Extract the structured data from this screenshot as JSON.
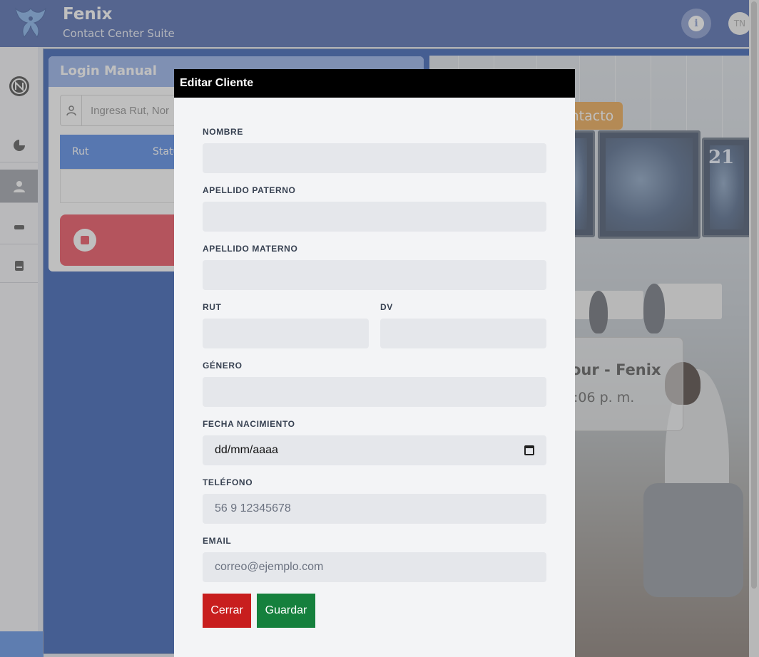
{
  "app": {
    "title": "Fenix",
    "subtitle": "Contact Center Suite",
    "avatar_initials": "TN",
    "info_icon": "i"
  },
  "sidebar": {
    "items": [
      {
        "icon": "logo-circle-icon"
      },
      {
        "icon": "pie-chart-icon"
      },
      {
        "icon": "user-icon",
        "active": true
      },
      {
        "icon": "minus-icon"
      },
      {
        "icon": "document-icon"
      }
    ]
  },
  "login": {
    "title": "Login Manual",
    "search_placeholder": "Ingresa Rut, Nor",
    "columns": [
      "Rut",
      "Statu"
    ]
  },
  "background": {
    "contact_button": "ontacto",
    "tour_title": "our - Fenix",
    "tour_time": ":06 p. m.",
    "monitor_number": "21"
  },
  "modal": {
    "title": "Editar Cliente",
    "fields": {
      "nombre": {
        "label": "NOMBRE",
        "value": "",
        "placeholder": ""
      },
      "apellido_paterno": {
        "label": "APELLIDO PATERNO",
        "value": "",
        "placeholder": ""
      },
      "apellido_materno": {
        "label": "APELLIDO MATERNO",
        "value": "",
        "placeholder": ""
      },
      "rut": {
        "label": "RUT",
        "value": "",
        "placeholder": ""
      },
      "dv": {
        "label": "DV",
        "value": "",
        "placeholder": ""
      },
      "genero": {
        "label": "GÉNERO",
        "value": "",
        "placeholder": ""
      },
      "fecha_nacimiento": {
        "label": "FECHA NACIMIENTO",
        "value": "dd/mm/aaaa"
      },
      "telefono": {
        "label": "TELÉFONO",
        "value": "",
        "placeholder": "56 9 12345678"
      },
      "email": {
        "label": "EMAIL",
        "value": "",
        "placeholder": "correo@ejemplo.com"
      }
    },
    "buttons": {
      "close": "Cerrar",
      "save": "Guardar"
    }
  },
  "colors": {
    "header": "#2b4a9e",
    "close_button": "#c81e1e",
    "save_button": "#15803d",
    "modal_header": "#000000"
  }
}
